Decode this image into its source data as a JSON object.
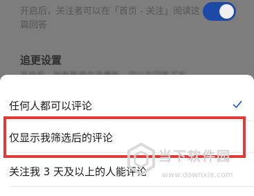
{
  "background": {
    "line1": "开启后，关注者可以在「首页 - 关注」阅读这",
    "line2": "篇回答",
    "section_title": "追更设置",
    "section_desc": "开启后，如有新用户追更新，可以在回答下方"
  },
  "toggle": {
    "state": "on",
    "color": "#1d4aa6"
  },
  "comment_options": {
    "options": [
      {
        "label": "任何人都可以评论",
        "selected": true
      },
      {
        "label": "仅显示我筛选后的评论",
        "selected": false
      },
      {
        "label": "关注我 3 天及以上的人能评论",
        "selected": false
      }
    ]
  },
  "highlight_color": "#e23a34",
  "watermark": {
    "name": "当下软件园",
    "url": "www.downxia.com"
  }
}
